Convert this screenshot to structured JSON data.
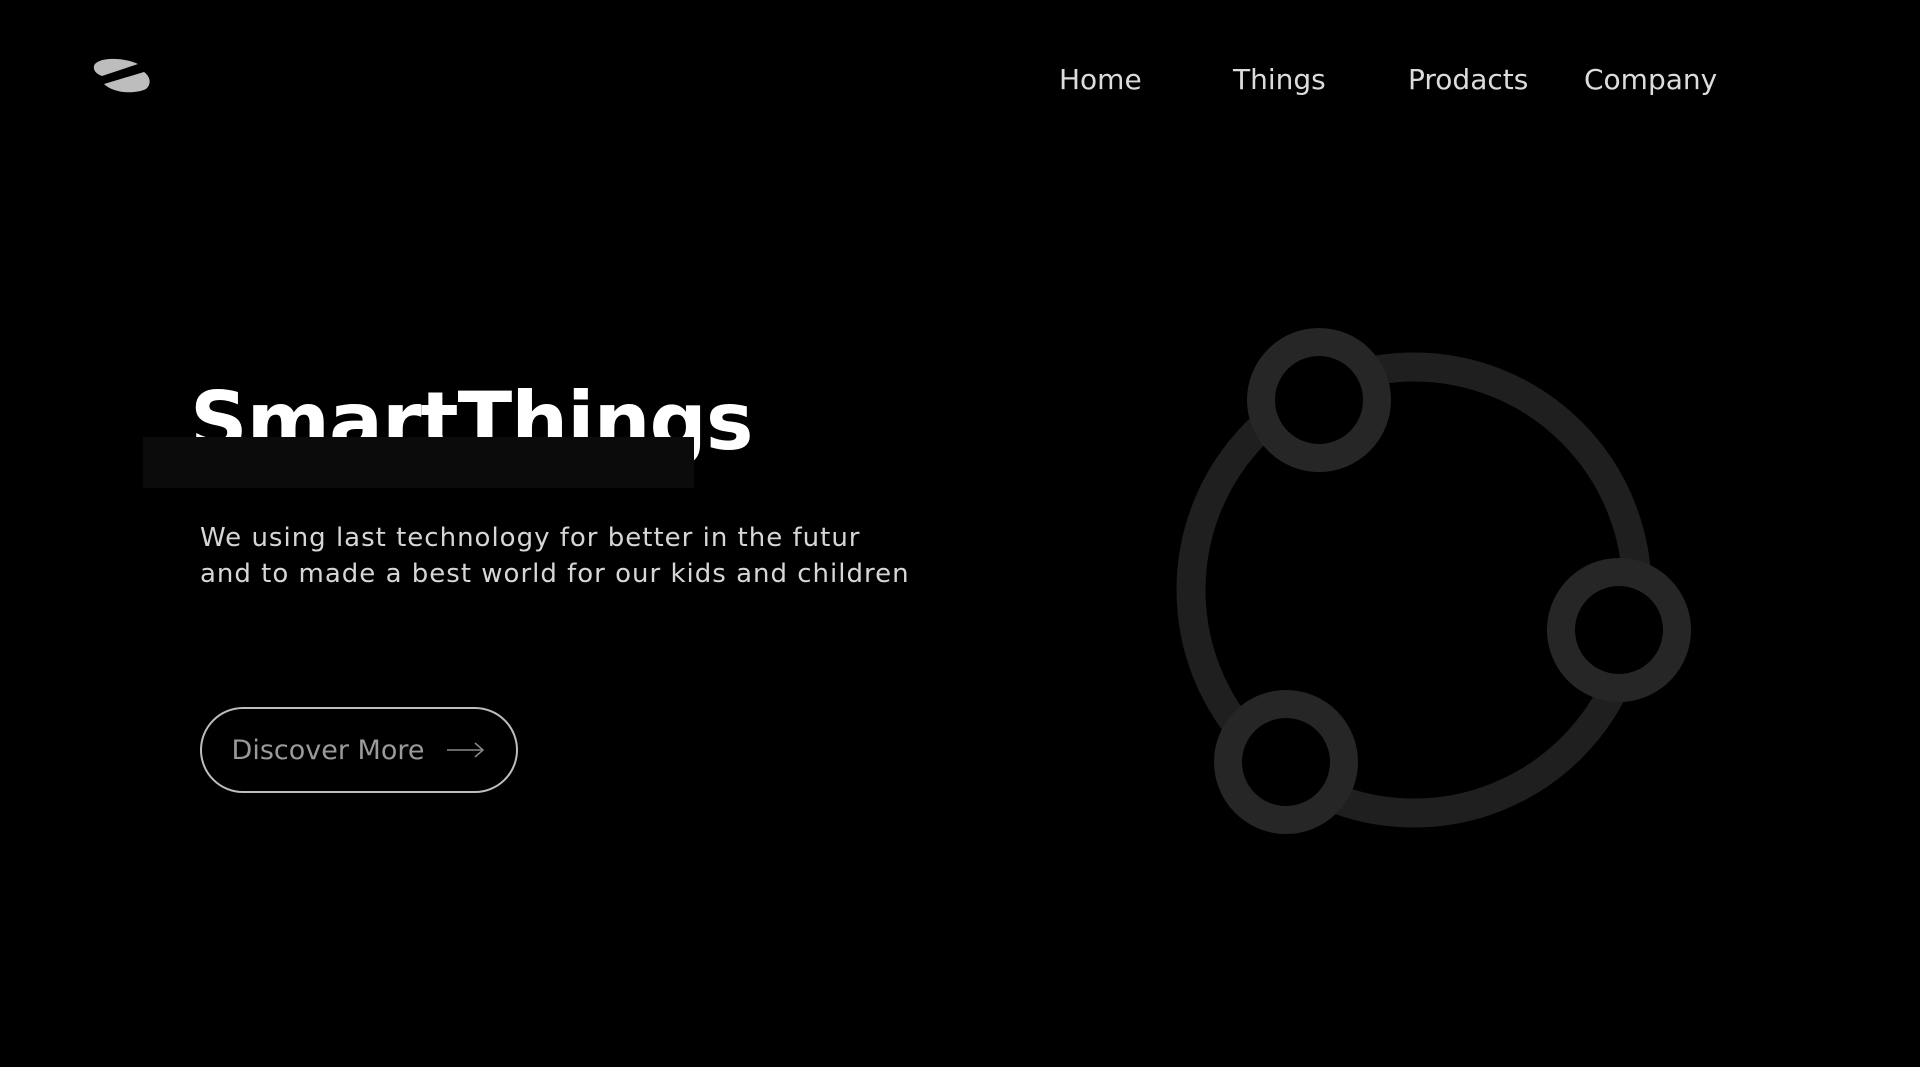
{
  "header": {
    "logo_icon": "leaf-logo-icon",
    "nav": [
      {
        "label": "Home"
      },
      {
        "label": "Things"
      },
      {
        "label": "Prodacts"
      },
      {
        "label": "Company"
      }
    ]
  },
  "hero": {
    "title": "SmartThings",
    "subtitle_lines": [
      "We using last technology for better in the futur",
      "and to made a best world for our kids and children"
    ],
    "cta": {
      "label": "Discover More",
      "icon": "arrow-right-icon"
    }
  },
  "graphic": {
    "icon": "connected-nodes-icon"
  },
  "colors": {
    "background": "#000000",
    "text_primary": "#ffffff",
    "text_secondary": "#d6d6d6",
    "nav_text": "#dcdcdc",
    "button_border": "#bdbdbd",
    "button_text": "#9a9a9a",
    "graphic_ring": "#1f1f1f",
    "graphic_node": "#262626"
  }
}
